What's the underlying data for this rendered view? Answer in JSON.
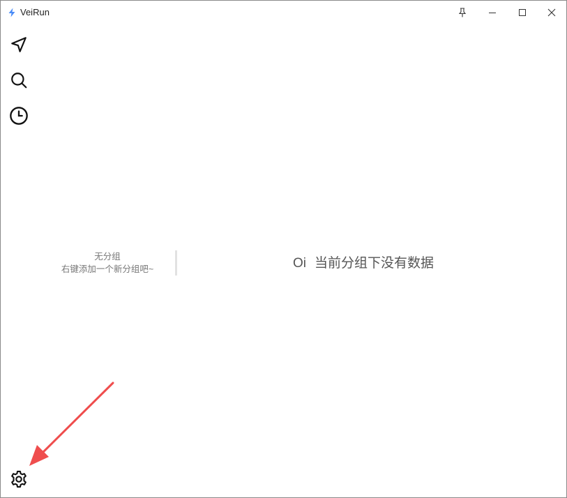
{
  "window": {
    "title": "VeiRun",
    "logo_icon": "lightning-icon",
    "accent_color": "#3b82f6",
    "controls": [
      "pin-icon",
      "minimize-icon",
      "maximize-icon",
      "close-icon"
    ]
  },
  "sidebar": {
    "items": [
      {
        "icon": "send-icon"
      },
      {
        "icon": "search-icon"
      },
      {
        "icon": "history-clock-icon"
      }
    ],
    "settings_icon": "gear-icon"
  },
  "groups": {
    "title": "无分组",
    "hint": "右键添加一个新分组吧~"
  },
  "main": {
    "empty_emoji": "Oi",
    "empty_text": "当前分组下没有数据"
  },
  "annotation": {
    "arrow_color": "#ef4d4d"
  }
}
